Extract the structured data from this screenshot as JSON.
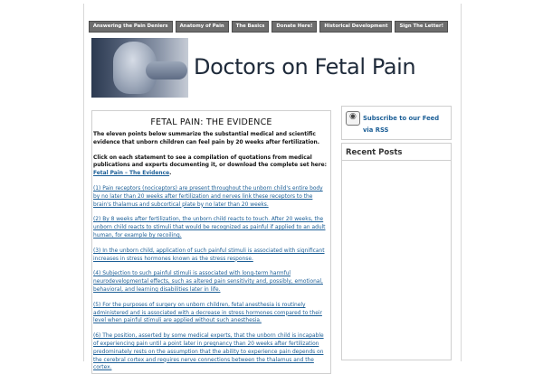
{
  "nav": {
    "items": [
      "Answering the Pain Deniers",
      "Anatomy of Pain",
      "The Basics",
      "Donate Here!",
      "Historical Development",
      "Sign The Letter!"
    ]
  },
  "header": {
    "site_title": "Doctors on Fetal Pain"
  },
  "main": {
    "title": "FETAL PAIN: THE EVIDENCE",
    "intro": "The eleven points below summarize the substantial medical and scientific evidence that unborn children can feel pain by 20 weeks after fertilization.",
    "click_text": "Click on each statement to see a compilation of quotations from medical publications and experts documenting it, or download the complete set here: ",
    "click_link": "Fetal Pain – The Evidence",
    "click_end": ".",
    "points": [
      "(1) Pain receptors (nociceptors) are present throughout the unborn child's entire body by no later than 20 weeks after fertilization and nerves link these receptors to the brain's thalamus and subcortical plate by no later than 20 weeks.",
      "(2) By 8 weeks after fertilization, the unborn child reacts to touch. After 20 weeks, the unborn child reacts to stimuli that would be recognized as painful if applied to an adult human, for example by recoiling.",
      "(3) In the unborn child, application of such painful stimuli is associated with significant increases in stress hormones known as the stress response.",
      "(4) Subjection to such painful stimuli is associated with long-term harmful neurodevelopmental effects, such as altered pain sensitivity and, possibly, emotional, behavioral, and learning disabilities later in life.",
      "(5) For the purposes of surgery on unborn children, fetal anesthesia is routinely administered and is associated with a decrease in stress hormones compared to their level when painful stimuli are applied without such anesthesia.",
      "(6) The position, asserted by some medical experts, that the unborn child is incapable of experiencing pain until a point later in pregnancy than 20 weeks after fertilization predominately rests on the assumption that the ability to experience pain depends on the cerebral cortex and requires nerve connections between the thalamus and the cortex."
    ]
  },
  "sidebar": {
    "rss_label": "Subscribe to our Feed via RSS",
    "recent_title": "Recent Posts"
  }
}
